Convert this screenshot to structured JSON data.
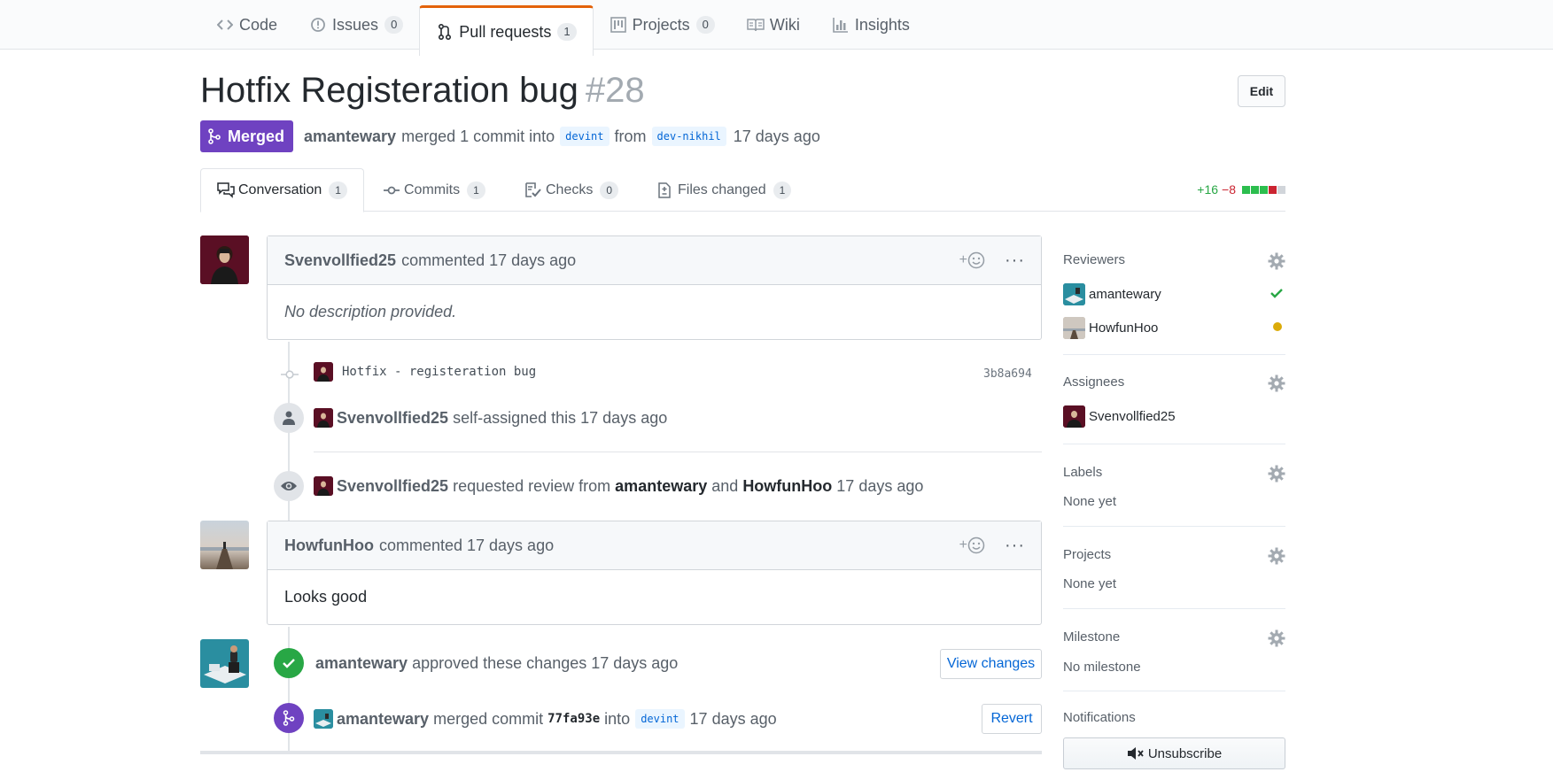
{
  "repo_nav": {
    "tabs": [
      {
        "label": "Code",
        "icon": "code-icon",
        "counter": null
      },
      {
        "label": "Issues",
        "icon": "issue-icon",
        "counter": "0"
      },
      {
        "label": "Pull requests",
        "icon": "pull-request-icon",
        "counter": "1",
        "selected": true
      },
      {
        "label": "Projects",
        "icon": "project-icon",
        "counter": "0"
      },
      {
        "label": "Wiki",
        "icon": "book-icon",
        "counter": null
      },
      {
        "label": "Insights",
        "icon": "graph-icon",
        "counter": null
      }
    ]
  },
  "header": {
    "title": "Hotfix Registeration bug",
    "number": "#28",
    "edit_label": "Edit",
    "state": "Merged",
    "author": "amantewary",
    "merge_text": "merged 1 commit into",
    "base_branch": "devint",
    "from_text": "from",
    "head_branch": "dev-nikhil",
    "time": "17 days ago"
  },
  "pr_tabs": [
    {
      "label": "Conversation",
      "counter": "1",
      "icon": "comment-discussion-icon",
      "selected": true
    },
    {
      "label": "Commits",
      "counter": "1",
      "icon": "git-commit-icon"
    },
    {
      "label": "Checks",
      "counter": "0",
      "icon": "checklist-icon"
    },
    {
      "label": "Files changed",
      "counter": "1",
      "icon": "file-diff-icon"
    }
  ],
  "diffstat": {
    "additions": "+16",
    "deletions": "−8",
    "blocks": [
      "#2cbe4e",
      "#2cbe4e",
      "#2cbe4e",
      "#cb2431",
      "#d1d5da"
    ]
  },
  "timeline": {
    "comment1": {
      "author": "Svenvollfied25",
      "action": "commented 17 days ago",
      "body": "No description provided."
    },
    "commit": {
      "message": "Hotfix - registeration bug",
      "sha": "3b8a694"
    },
    "self_assign": {
      "actor": "Svenvollfied25",
      "text": "self-assigned this 17 days ago"
    },
    "review_request": {
      "actor": "Svenvollfied25",
      "text": "requested review from",
      "reviewer1": "amantewary",
      "and": "and",
      "reviewer2": "HowfunHoo",
      "time": "17 days ago"
    },
    "comment2": {
      "author": "HowfunHoo",
      "action": "commented 17 days ago",
      "body": "Looks good"
    },
    "approval": {
      "actor": "amantewary",
      "text": "approved these changes 17 days ago",
      "button": "View changes"
    },
    "merge": {
      "actor": "amantewary",
      "text": "merged commit",
      "sha": "77fa93e",
      "into": "into",
      "branch": "devint",
      "time": "17 days ago",
      "button": "Revert"
    }
  },
  "sidebar": {
    "reviewers": {
      "heading": "Reviewers",
      "items": [
        {
          "name": "amantewary",
          "status": "approved",
          "status_color": "#28a745"
        },
        {
          "name": "HowfunHoo",
          "status": "pending",
          "status_color": "#dbab09"
        }
      ]
    },
    "assignees": {
      "heading": "Assignees",
      "items": [
        {
          "name": "Svenvollfied25"
        }
      ]
    },
    "labels": {
      "heading": "Labels",
      "value": "None yet"
    },
    "projects": {
      "heading": "Projects",
      "value": "None yet"
    },
    "milestone": {
      "heading": "Milestone",
      "value": "No milestone"
    },
    "notifications": {
      "heading": "Notifications",
      "button": "Unsubscribe"
    }
  },
  "colors": {
    "merged_purple": "#6f42c1",
    "approved_green": "#28a745",
    "link_blue": "#0366d6",
    "active_tab_orange": "#e36209"
  }
}
